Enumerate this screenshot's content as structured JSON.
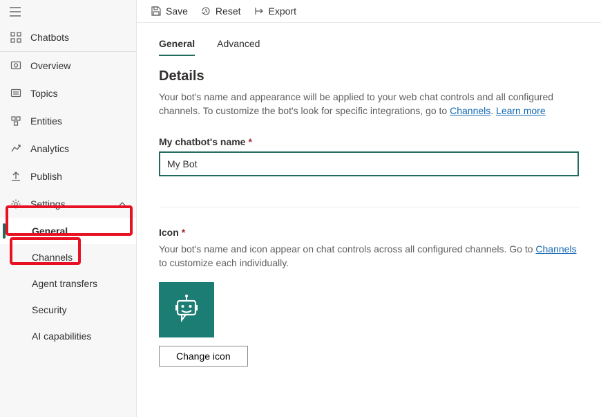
{
  "sidebar": {
    "chatbots": "Chatbots",
    "items": [
      {
        "label": "Overview"
      },
      {
        "label": "Topics"
      },
      {
        "label": "Entities"
      },
      {
        "label": "Analytics"
      },
      {
        "label": "Publish"
      }
    ],
    "settings_label": "Settings",
    "settings_children": [
      {
        "label": "General"
      },
      {
        "label": "Channels"
      },
      {
        "label": "Agent transfers"
      },
      {
        "label": "Security"
      },
      {
        "label": "AI capabilities"
      }
    ]
  },
  "toolbar": {
    "save": "Save",
    "reset": "Reset",
    "export": "Export"
  },
  "tabs": {
    "general": "General",
    "advanced": "Advanced"
  },
  "details": {
    "heading": "Details",
    "description_pre": "Your bot's name and appearance will be applied to your web chat controls and all configured channels. To customize the bot's look for specific integrations, go to ",
    "channels_link": "Channels",
    "dot": ". ",
    "learn_more": "Learn more",
    "name_label": "My chatbot's name",
    "name_value": "My Bot"
  },
  "icon_section": {
    "label": "Icon",
    "description_pre": "Your bot's name and icon appear on chat controls across all configured channels. Go to ",
    "channels_link": "Channels",
    "description_post": " to customize each individually.",
    "change_btn": "Change icon"
  }
}
